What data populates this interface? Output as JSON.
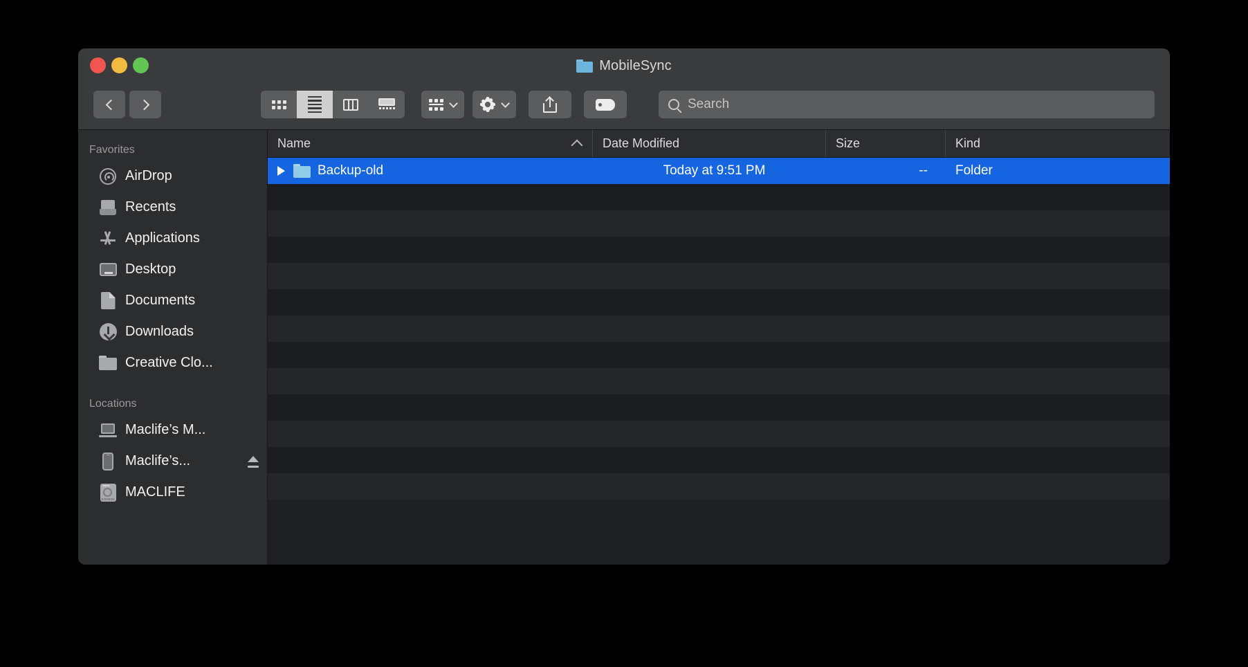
{
  "window": {
    "title": "MobileSync",
    "title_icon": "folder-icon",
    "traffic_lights": [
      {
        "name": "close",
        "color": "#f0564f"
      },
      {
        "name": "minimize",
        "color": "#f1bb3f"
      },
      {
        "name": "maximize",
        "color": "#62c554"
      }
    ]
  },
  "toolbar": {
    "back_icon": "chevron-left-icon",
    "forward_icon": "chevron-right-icon",
    "view_modes": [
      {
        "name": "icon-view",
        "icon": "grid-icon",
        "active": false
      },
      {
        "name": "list-view",
        "icon": "list-icon",
        "active": true
      },
      {
        "name": "column-view",
        "icon": "columns-icon",
        "active": false
      },
      {
        "name": "gallery-view",
        "icon": "gallery-icon",
        "active": false
      }
    ],
    "group_by_icon": "group-items-icon",
    "group_by_caret": "chevron-down-icon",
    "action_icon": "gear-icon",
    "action_caret": "chevron-down-icon",
    "share_icon": "share-icon",
    "tag_icon": "tag-icon"
  },
  "search": {
    "icon": "search-icon",
    "placeholder": "Search",
    "value": ""
  },
  "sidebar": {
    "sections": [
      {
        "title": "Favorites",
        "items": [
          {
            "label": "AirDrop",
            "icon": "airdrop-icon"
          },
          {
            "label": "Recents",
            "icon": "recents-icon"
          },
          {
            "label": "Applications",
            "icon": "applications-icon"
          },
          {
            "label": "Desktop",
            "icon": "desktop-icon"
          },
          {
            "label": "Documents",
            "icon": "documents-icon"
          },
          {
            "label": "Downloads",
            "icon": "downloads-icon"
          },
          {
            "label": "Creative Clo...",
            "icon": "folder-icon"
          }
        ]
      },
      {
        "title": "Locations",
        "items": [
          {
            "label": "Maclife’s M...",
            "icon": "laptop-icon",
            "eject": false
          },
          {
            "label": "Maclife’s...",
            "icon": "iphone-icon",
            "eject": true
          },
          {
            "label": "MACLIFE",
            "icon": "hard-drive-icon",
            "eject": false
          }
        ]
      }
    ]
  },
  "file_list": {
    "columns": [
      {
        "label": "Name",
        "sorted": true,
        "sort_direction": "asc"
      },
      {
        "label": "Date Modified",
        "sorted": false
      },
      {
        "label": "Size",
        "sorted": false
      },
      {
        "label": "Kind",
        "sorted": false
      }
    ],
    "rows": [
      {
        "name": "Backup-old",
        "date_modified": "Today at 9:51 PM",
        "size": "--",
        "kind": "Folder",
        "icon": "folder-icon",
        "disclosure": "disclosure-triangle-icon",
        "selected": true
      }
    ],
    "empty_row_count": 12
  },
  "colors": {
    "selection": "#1565e0",
    "window_chrome": "#3a3b3d",
    "sidebar_bg": "#2c2d2f",
    "list_bg": "#1e2024",
    "folder_blue": "#92cbe6"
  }
}
